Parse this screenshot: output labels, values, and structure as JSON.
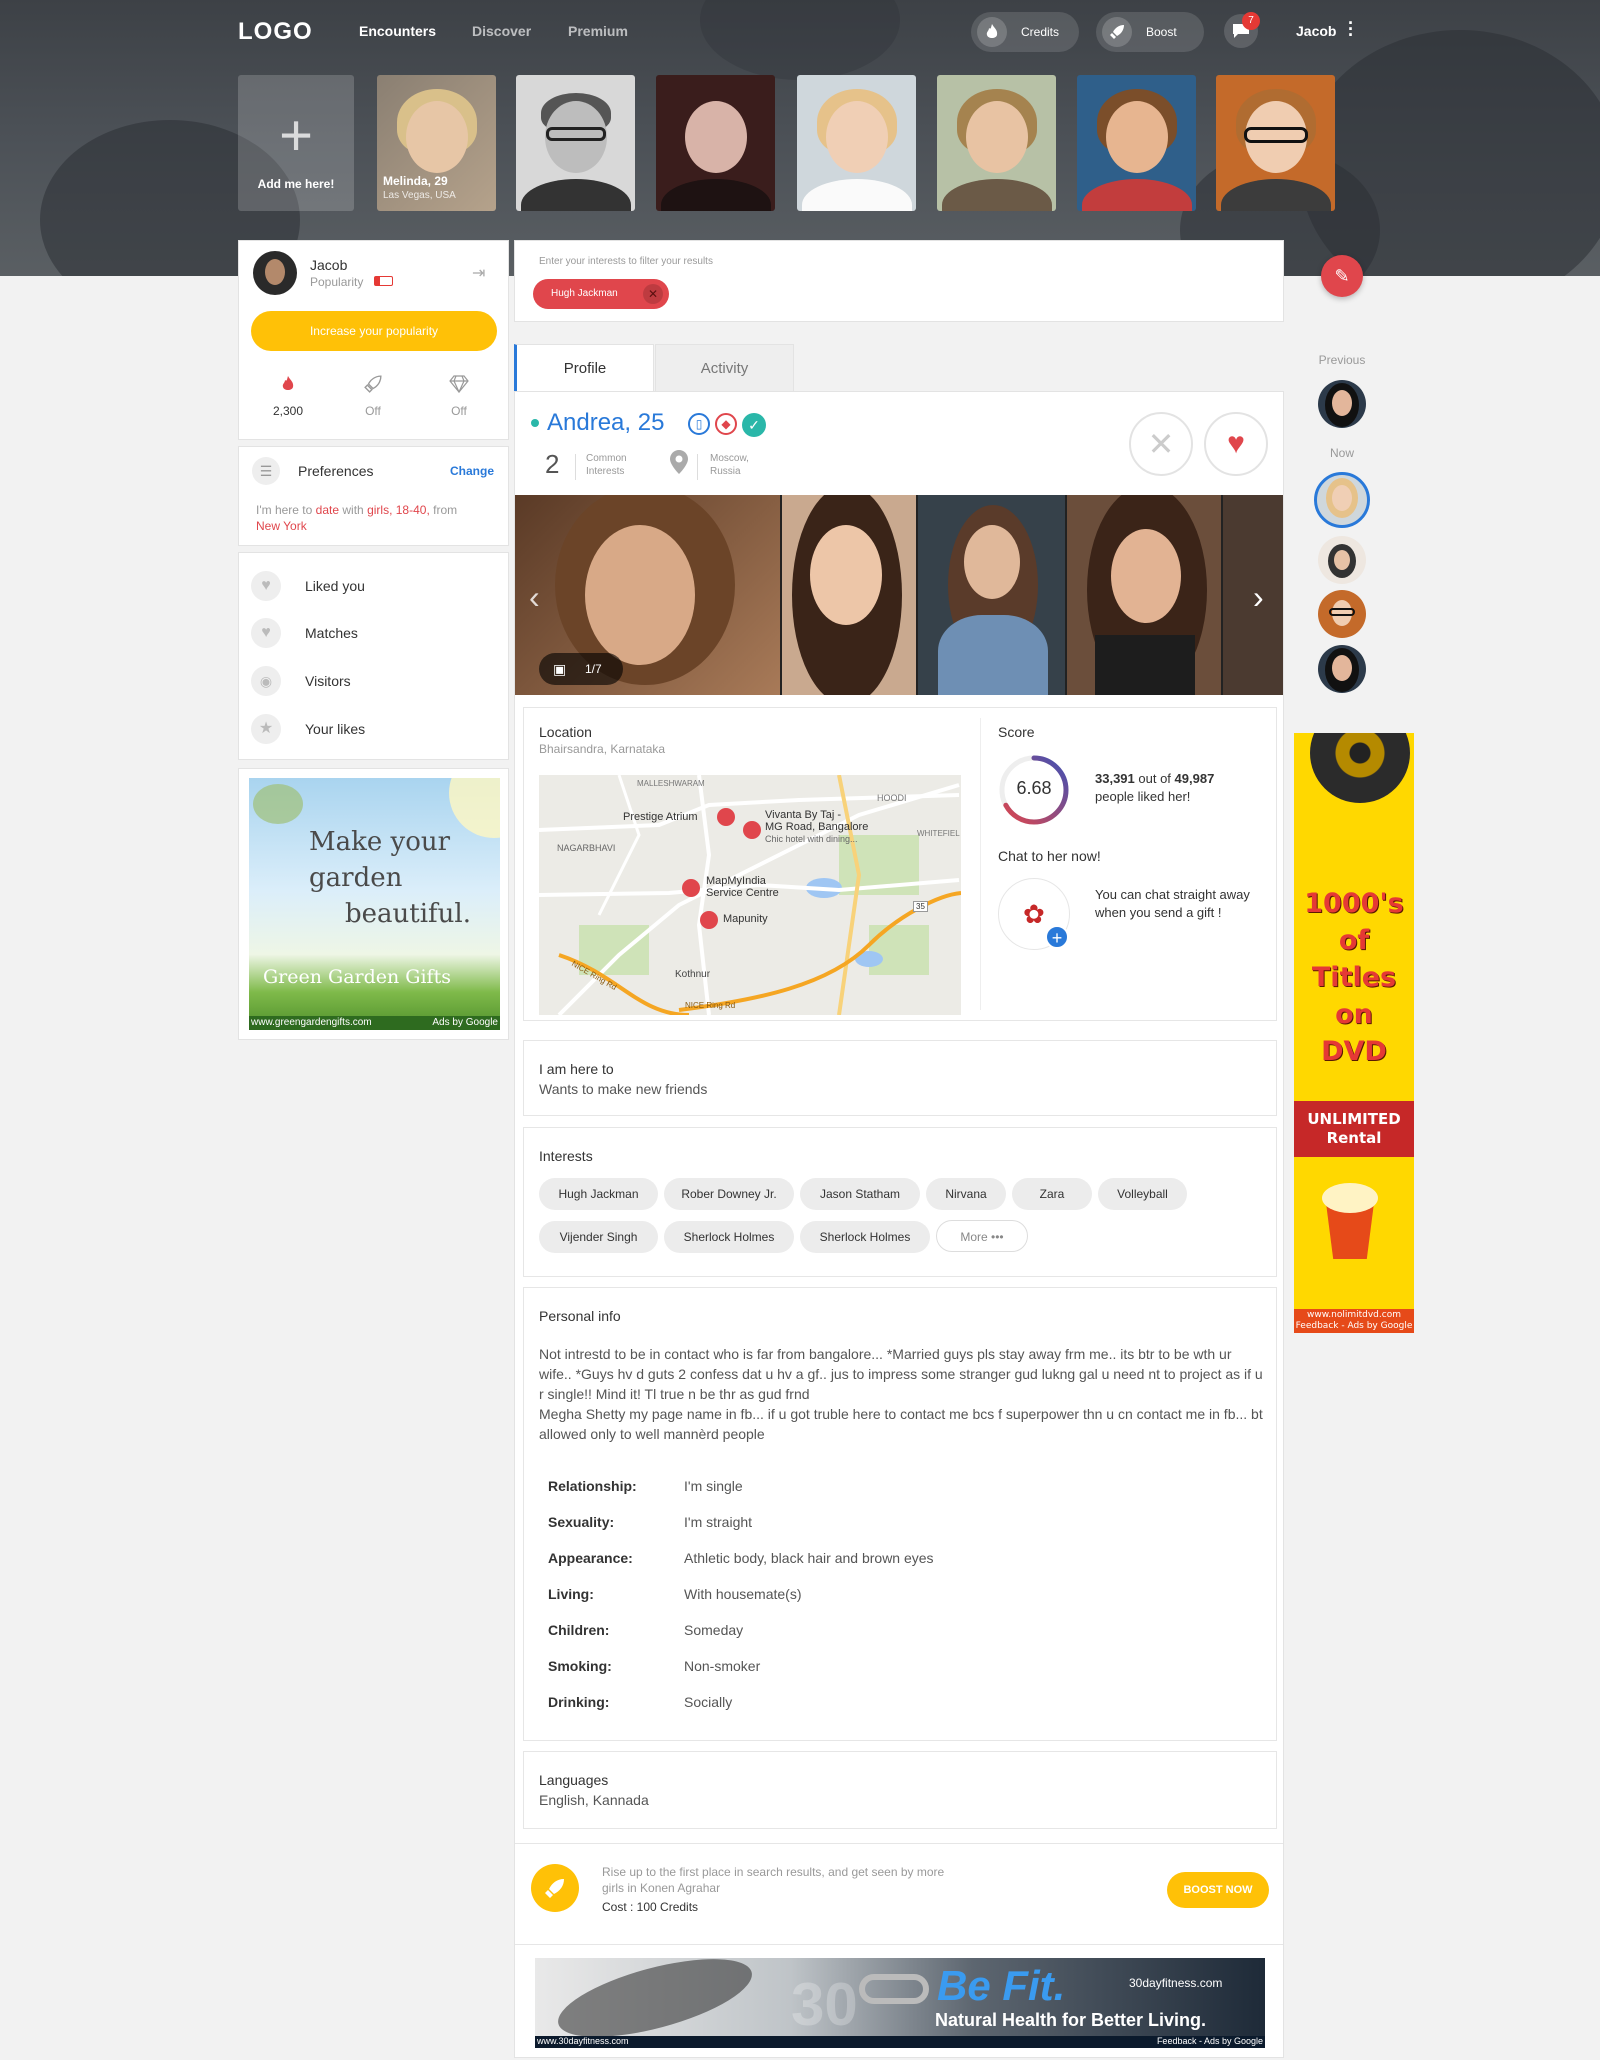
{
  "nav": {
    "logo": "LOGO",
    "links": [
      "Encounters",
      "Discover",
      "Premium"
    ],
    "credits_label": "Credits",
    "boost_label": "Boost",
    "messages_badge": "7",
    "username": "Jacob"
  },
  "strip": {
    "add_me": "Add me here!",
    "featured_name": "Melinda, 29",
    "featured_location": "Las Vegas, USA"
  },
  "sidebar": {
    "user_name": "Jacob",
    "popularity_label": "Popularity",
    "popularity_button": "Increase your popularity",
    "stats": [
      {
        "icon": "flame-icon",
        "value": "2,300"
      },
      {
        "icon": "rocket-icon",
        "value": "Off"
      },
      {
        "icon": "diamond-icon",
        "value": "Off"
      }
    ],
    "preferences_title": "Preferences",
    "preferences_change": "Change",
    "pref_here_to": "I'm here to",
    "pref_date": "date",
    "pref_with": "with",
    "pref_girls": "girls,",
    "pref_ages": "18-40,",
    "pref_from": "from",
    "pref_city": "New York",
    "menu": [
      "Liked you",
      "Matches",
      "Visitors",
      "Your likes"
    ],
    "ad": {
      "line1": "Make your",
      "line2": "garden",
      "line3": "beautiful.",
      "brand": "Green Garden Gifts",
      "url": "www.greengardengifts.com",
      "ads_by": "Ads by Google"
    }
  },
  "filter": {
    "hint": "Enter your interests to filter your results",
    "chip": "Hugh Jackman"
  },
  "tabs": [
    "Profile",
    "Activity"
  ],
  "profile": {
    "name_age": "Andrea, 25",
    "common_count": "2",
    "common_label_1": "Common",
    "common_label_2": "Interests",
    "city_1": "Moscow,",
    "city_2": "Russia",
    "photo_counter": "1/7",
    "location_title": "Location",
    "location_sub": "Bhairsandra, Karnataka",
    "map_labels": {
      "malleshwaram": "MALLESHWARAM",
      "hoodi": "HOODI",
      "whitefield": "WHITEFIEL",
      "nagarbhavi": "NAGARBHAVI",
      "prestige": "Prestige Atrium",
      "vivanta_1": "Vivanta By Taj -",
      "vivanta_2": "MG Road, Bangalore",
      "vivanta_3": "Chic hotel with dining...",
      "mapmyindia_1": "MapMyIndia",
      "mapmyindia_2": "Service Centre",
      "mapunity": "Mapunity",
      "kothnur": "Kothnur",
      "ring1": "NICE Ring Rd",
      "ring2": "NICE Ring Rd",
      "route": "35"
    },
    "score_title": "Score",
    "score_value": "6.68",
    "liked_count": "33,391",
    "liked_of": "out of",
    "liked_total": "49,987",
    "liked_suffix": "people liked her!",
    "score_fraction": 0.67,
    "chat_title": "Chat to her now!",
    "chat_text": "You can chat straight away when you send a gift !",
    "here_to_title": "I am here to",
    "here_to_value": "Wants to make new friends",
    "interests_title": "Interests",
    "interests": [
      "Hugh Jackman",
      "Rober Downey Jr.",
      "Jason Statham",
      "Nirvana",
      "Zara",
      "Volleyball",
      "Vijender Singh",
      "Sherlock Holmes",
      "Sherlock Holmes"
    ],
    "more_label": "More",
    "personal_title": "Personal info",
    "bio_1": "Not intrestd to be in contact who is far from bangalore... *Married guys pls stay away frm me.. its btr to be wth ur wife.. *Guys hv d guts 2 confess dat u hv a gf.. jus to impress some stranger gud lukng gal u need nt to project as if u r single!! Mind it! Tl true n be thr as gud frnd",
    "bio_2": "Megha Shetty my page name in fb... if u got truble here to contact me bcs f superpower thn u cn contact me in fb... bt allowed only to well mannèrd people",
    "details": [
      {
        "k": "Relationship:",
        "v": "I'm single"
      },
      {
        "k": "Sexuality:",
        "v": "I'm straight"
      },
      {
        "k": "Appearance:",
        "v": "Athletic body, black hair and brown eyes"
      },
      {
        "k": "Living:",
        "v": "With housemate(s)"
      },
      {
        "k": "Children:",
        "v": "Someday"
      },
      {
        "k": "Smoking:",
        "v": "Non-smoker"
      },
      {
        "k": "Drinking:",
        "v": "Socially"
      }
    ],
    "languages_title": "Languages",
    "languages_value": "English, Kannada"
  },
  "boost": {
    "text_1": "Rise up to the first place in search results, and get seen by more",
    "text_2": "girls in Konen Agrahar",
    "cost": "Cost : 100 Credits",
    "button": "BOOST NOW"
  },
  "bottom_ad": {
    "headline": "Be Fit.",
    "tagline": "Natural Health for Better Living.",
    "domain": "30dayfitness.com",
    "url": "www.30dayfitness.com",
    "feedback": "Feedback - Ads by Google",
    "big_number": "30"
  },
  "right_rail": {
    "previous_label": "Previous",
    "now_label": "Now",
    "ad": {
      "line1": "1000's",
      "line2": "of",
      "line3": "Titles",
      "line4": "on",
      "line5": "DVD",
      "band_1": "UNLIMITED",
      "band_2": "Rental",
      "url": "www.nolimitdvd.com",
      "feedback": "Feedback - Ads by Google"
    }
  },
  "colors": {
    "accent_blue": "#2979d9",
    "accent_red": "#e0464c",
    "accent_yellow": "#ffc107",
    "online_green": "#2ab7a9"
  }
}
